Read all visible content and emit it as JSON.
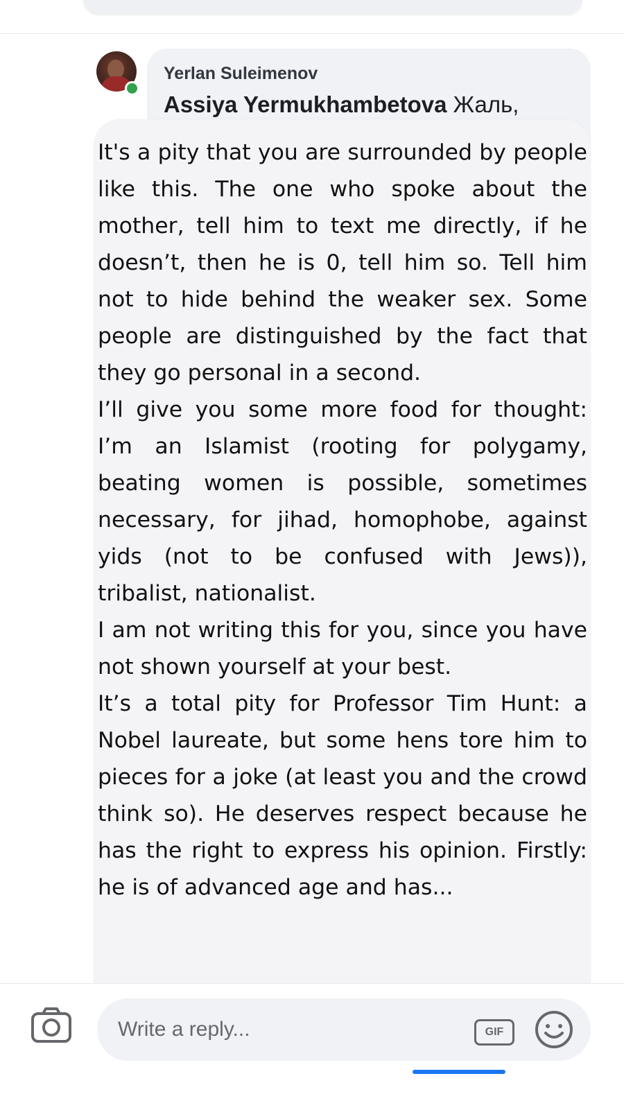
{
  "comment": {
    "author": "Yerlan Suleimenov",
    "mention": "Assiya Yermukhambetova",
    "text_preview": "Жаль,"
  },
  "translation": {
    "paragraphs": [
      "It's a pity that you are surrounded by people like this. The one who spoke about the mother, tell him to text me directly, if he doesn’t, then he is 0, tell him so. Tell him not to hide behind the weaker sex. Some people are distinguished by the fact that they go personal in a second.",
      "I’ll give you some more food for thought: I’m an Islamist (rooting for polygamy, beating women is possible, sometimes necessary, for jihad, homophobe, against yids (not to be confused with Jews)), tribalist, nationalist.",
      "I am not writing this for you, since you have not shown yourself at your best.",
      "It’s a total pity for Professor Tim Hunt: a Nobel laureate, but some hens tore him to pieces for a joke (at least you and the crowd think so). He deserves respect because he has the right to express his opinion. Firstly: he is of advanced age and has..."
    ]
  },
  "reply_bar": {
    "placeholder": "Write a reply...",
    "gif_label": "GIF",
    "icons": {
      "camera": "camera-icon",
      "gif": "gif-icon",
      "emoji": "emoji-icon"
    }
  },
  "colors": {
    "bubble": "#f0f2f5",
    "translation_card": "#f4f4f7",
    "online": "#31a24c",
    "accent": "#1877f2"
  }
}
